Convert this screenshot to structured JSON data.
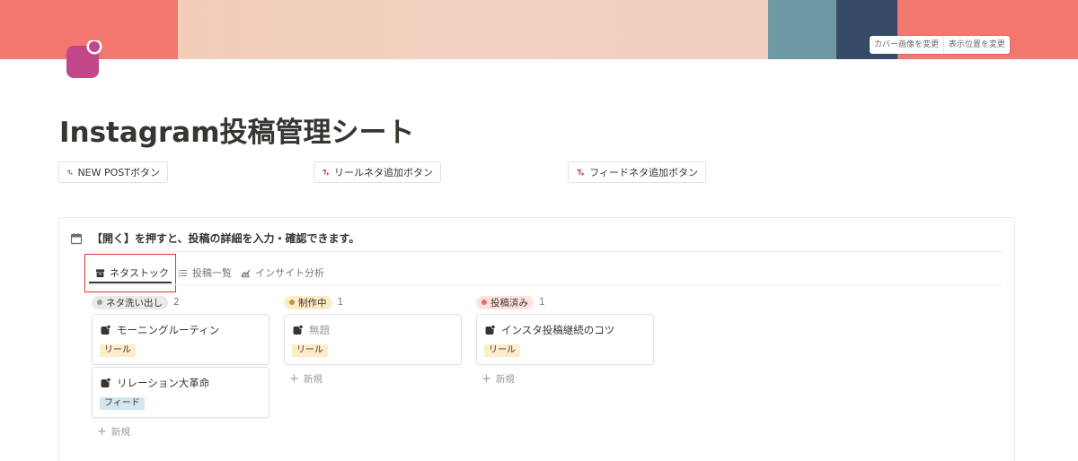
{
  "cover": {
    "colors": {
      "coral": "#f2776f",
      "paper": "#f3cdb9",
      "teal": "#6f99a2",
      "navy": "#344a66"
    },
    "actions": {
      "change_cover": "カバー画像を変更",
      "reposition": "表示位置を変更"
    }
  },
  "page": {
    "icon": "instagram-square-icon",
    "icon_color": "#c2478a",
    "title": "Instagram投稿管理シート"
  },
  "template_buttons": [
    {
      "label": "NEW POSTボタン",
      "icon": "template-button-icon"
    },
    {
      "label": "リールネタ追加ボタン",
      "icon": "template-button-icon"
    },
    {
      "label": "フィードネタ追加ボタン",
      "icon": "template-button-icon"
    }
  ],
  "callout": {
    "icon": "calendar-icon",
    "text": "【開く】を押すと、投稿の詳細を入力・確認できます。"
  },
  "tabs": [
    {
      "label": "ネタストック",
      "icon": "archive-icon",
      "active": true
    },
    {
      "label": "投稿一覧",
      "icon": "list-icon",
      "active": false
    },
    {
      "label": "インサイト分析",
      "icon": "chart-icon",
      "active": false
    }
  ],
  "board": {
    "new_label": "新規",
    "columns": [
      {
        "status": "ネタ洗い出し",
        "count": "2",
        "pill_bg": "#e9e9e7",
        "dot": "#9b9a97",
        "cards": [
          {
            "title": "モーニングルーティン",
            "tag": "リール",
            "tag_bg": "#fdecc8"
          },
          {
            "title": "リレーション大革命",
            "tag": "フィード",
            "tag_bg": "#d3e5ef"
          }
        ]
      },
      {
        "status": "制作中",
        "count": "1",
        "pill_bg": "#fdecc8",
        "dot": "#c29243",
        "cards": [
          {
            "title": "無題",
            "tag": "リール",
            "tag_bg": "#fdecc8",
            "untitled": true
          }
        ]
      },
      {
        "status": "投稿済み",
        "count": "1",
        "pill_bg": "#ffe2dd",
        "dot": "#e16f64",
        "cards": [
          {
            "title": "インスタ投稿継続のコツ",
            "tag": "リール",
            "tag_bg": "#fdecc8"
          }
        ]
      }
    ]
  }
}
